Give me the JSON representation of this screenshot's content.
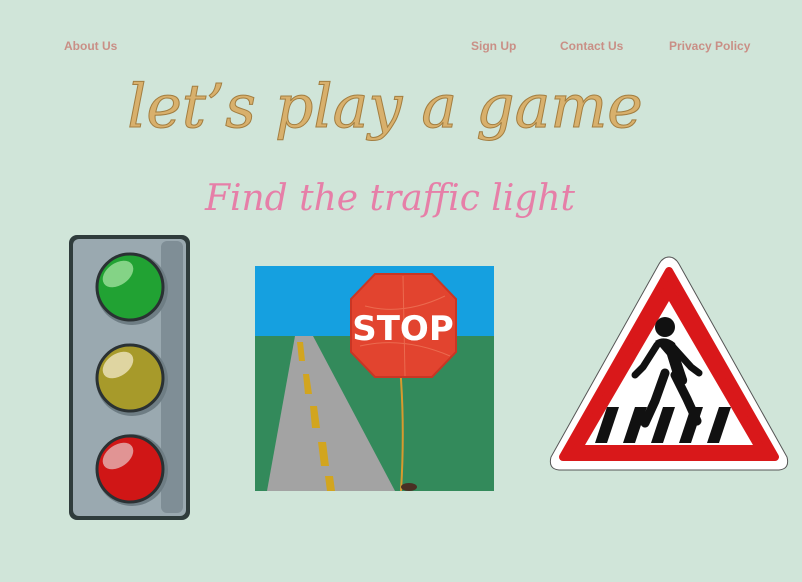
{
  "nav": {
    "about": "About Us",
    "signup": "Sign Up",
    "contact": "Contact Us",
    "privacy": "Privacy Policy"
  },
  "header": {
    "title": "let’s play a game",
    "subtitle": "Find the traffic light"
  },
  "images": {
    "traffic_light": "traffic-light",
    "stop_sign": "stop-sign",
    "pedestrian_crossing": "pedestrian-crossing-sign"
  },
  "stop_sign_text": "STOP",
  "colors": {
    "background": "#d0e5d9",
    "nav_link": "#c98f86",
    "title": "#d8b06c",
    "subtitle": "#e67fa8"
  }
}
